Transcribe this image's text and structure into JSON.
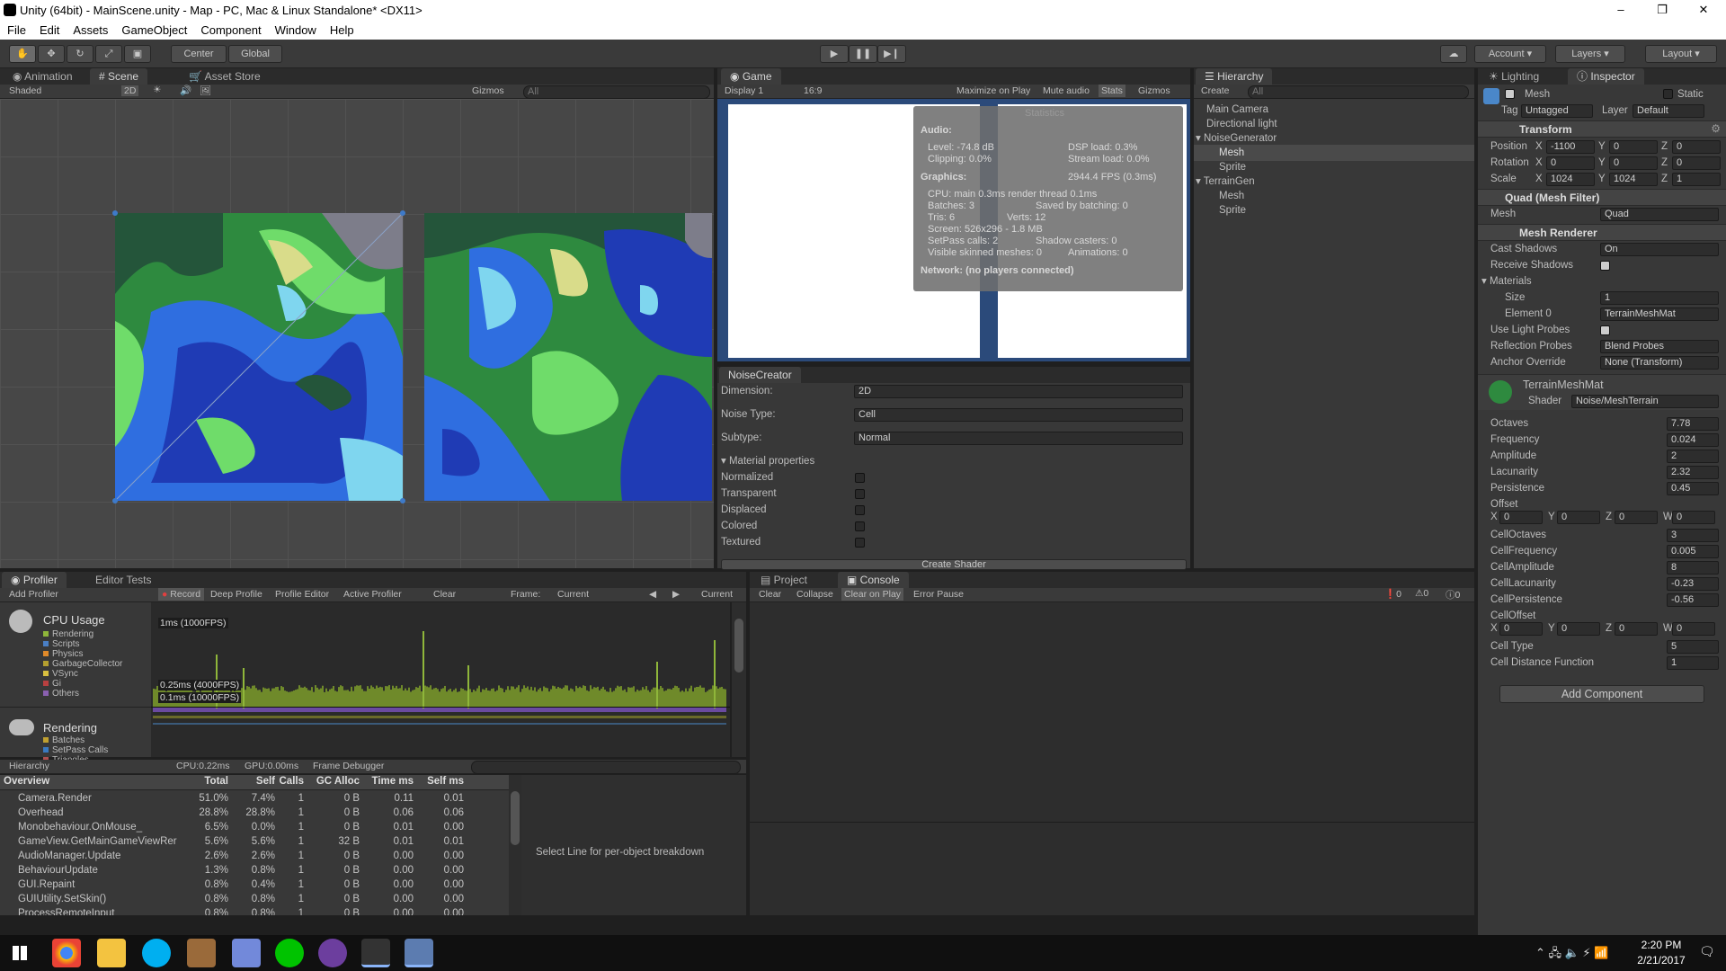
{
  "window": {
    "title": "Unity (64bit) - MainScene.unity - Map - PC, Mac & Linux Standalone* <DX11>",
    "minimize": "–",
    "maximize": "❐",
    "close": "✕"
  },
  "menu": [
    "File",
    "Edit",
    "Assets",
    "GameObject",
    "Component",
    "Window",
    "Help"
  ],
  "toolbar": {
    "center": "Center",
    "global": "Global",
    "account": "Account",
    "layers": "Layers",
    "layout": "Layout"
  },
  "scene_tabs": {
    "animation": "Animation",
    "scene": "Scene",
    "asset_store": "Asset Store",
    "shaded": "Shaded",
    "twod": "2D",
    "gizmos": "Gizmos",
    "search": "All"
  },
  "game": {
    "tab": "Game",
    "display": "Display 1",
    "aspect": "16:9",
    "maximize": "Maximize on Play",
    "mute": "Mute audio",
    "stats": "Stats",
    "gizmos": "Gizmos"
  },
  "stats": {
    "title": "Statistics",
    "audio": "Audio:",
    "level": "Level: -74.8 dB",
    "clipping": "Clipping: 0.0%",
    "dsp": "DSP load: 0.3%",
    "stream": "Stream load: 0.0%",
    "graphics": "Graphics:",
    "fps": "2944.4 FPS (0.3ms)",
    "cpu": "CPU: main 0.3ms  render thread 0.1ms",
    "batches": "Batches: 3",
    "saved": "Saved by batching: 0",
    "tris": "Tris: 6",
    "verts": "Verts: 12",
    "screen": "Screen: 526x296 - 1.8 MB",
    "setpass": "SetPass calls: 2",
    "shadow": "Shadow casters: 0",
    "skinned": "Visible skinned meshes: 0",
    "anims": "Animations: 0",
    "network": "Network: (no players connected)"
  },
  "noise": {
    "tab": "NoiseCreator",
    "dimension_label": "Dimension:",
    "dimension": "2D",
    "type_label": "Noise Type:",
    "type": "Cell",
    "subtype_label": "Subtype:",
    "subtype": "Normal",
    "material": "Material properties",
    "normalized": "Normalized",
    "transparent": "Transparent",
    "displaced": "Displaced",
    "colored": "Colored",
    "textured": "Textured",
    "create": "Create Shader"
  },
  "hierarchy": {
    "tab": "Hierarchy",
    "create": "Create",
    "search": "All",
    "items": [
      "Main Camera",
      "Directional light",
      "NoiseGenerator",
      "Mesh",
      "Sprite",
      "TerrainGen",
      "Mesh",
      "Sprite"
    ]
  },
  "inspector": {
    "lighting_tab": "Lighting",
    "tab": "Inspector",
    "name": "Mesh",
    "static": "Static",
    "tag_label": "Tag",
    "tag": "Untagged",
    "layer_label": "Layer",
    "layer": "Default",
    "transform": "Transform",
    "position": "Position",
    "rotation": "Rotation",
    "scale": "Scale",
    "pos": [
      "-1100",
      "0",
      "0"
    ],
    "rot": [
      "0",
      "0",
      "0"
    ],
    "scl": [
      "1024",
      "1024",
      "1"
    ],
    "x": "X",
    "y": "Y",
    "z": "Z",
    "w": "W",
    "mesh_filter": "Quad (Mesh Filter)",
    "mesh_label": "Mesh",
    "mesh_value": "Quad",
    "mesh_renderer": "Mesh Renderer",
    "cast_shadows": "Cast Shadows",
    "cast_value": "On",
    "receive_shadows": "Receive Shadows",
    "materials": "Materials",
    "size": "Size",
    "size_value": "1",
    "element0": "Element 0",
    "element0_value": "TerrainMeshMat",
    "light_probes": "Use Light Probes",
    "reflection": "Reflection Probes",
    "reflection_value": "Blend Probes",
    "anchor": "Anchor Override",
    "anchor_value": "None (Transform)",
    "material": "TerrainMeshMat",
    "shader_label": "Shader",
    "shader": "Noise/MeshTerrain",
    "props": [
      [
        "Octaves",
        "7.78"
      ],
      [
        "Frequency",
        "0.024"
      ],
      [
        "Amplitude",
        "2"
      ],
      [
        "Lacunarity",
        "2.32"
      ],
      [
        "Persistence",
        "0.45"
      ]
    ],
    "offset": "Offset",
    "offset_vals": [
      "0",
      "0",
      "0",
      "0"
    ],
    "props2": [
      [
        "CellOctaves",
        "3"
      ],
      [
        "CellFrequency",
        "0.005"
      ],
      [
        "CellAmplitude",
        "8"
      ],
      [
        "CellLacunarity",
        "-0.23"
      ],
      [
        "CellPersistence",
        "-0.56"
      ]
    ],
    "celloffset": "CellOffset",
    "celloffset_vals": [
      "0",
      "0",
      "0",
      "0"
    ],
    "props3": [
      [
        "Cell Type",
        "5"
      ],
      [
        "Cell Distance Function",
        "1"
      ]
    ],
    "add_component": "Add Component"
  },
  "profiler": {
    "tab": "Profiler",
    "editor_tests": "Editor Tests",
    "add": "Add Profiler",
    "record": "Record",
    "deep": "Deep Profile",
    "editor": "Profile Editor",
    "active": "Active Profiler",
    "clear": "Clear",
    "frame": "Frame:",
    "current": "Current",
    "current2": "Current",
    "cpu": "CPU Usage",
    "cpu_items": [
      "Rendering",
      "Scripts",
      "Physics",
      "GarbageCollector",
      "VSync",
      "Gi",
      "Others"
    ],
    "rendering": "Rendering",
    "rendering_items": [
      "Batches",
      "SetPass Calls",
      "Triangles"
    ],
    "lbl1": "1ms (1000FPS)",
    "lbl2": "0.25ms (4000FPS)",
    "lbl3": "0.1ms (10000FPS)",
    "hier": "Hierarchy",
    "cpu_time": "CPU:0.22ms",
    "gpu_time": "GPU:0.00ms",
    "frame_debugger": "Frame Debugger",
    "cols": [
      "Overview",
      "Total",
      "Self",
      "Calls",
      "GC Alloc",
      "Time ms",
      "Self ms"
    ],
    "rows": [
      [
        "Camera.Render",
        "51.0%",
        "7.4%",
        "1",
        "0 B",
        "0.11",
        "0.01"
      ],
      [
        "Overhead",
        "28.8%",
        "28.8%",
        "1",
        "0 B",
        "0.06",
        "0.06"
      ],
      [
        "Monobehaviour.OnMouse_",
        "6.5%",
        "0.0%",
        "1",
        "0 B",
        "0.01",
        "0.00"
      ],
      [
        "GameView.GetMainGameViewRer",
        "5.6%",
        "5.6%",
        "1",
        "32 B",
        "0.01",
        "0.01"
      ],
      [
        "AudioManager.Update",
        "2.6%",
        "2.6%",
        "1",
        "0 B",
        "0.00",
        "0.00"
      ],
      [
        "BehaviourUpdate",
        "1.3%",
        "0.8%",
        "1",
        "0 B",
        "0.00",
        "0.00"
      ],
      [
        "GUI.Repaint",
        "0.8%",
        "0.4%",
        "1",
        "0 B",
        "0.00",
        "0.00"
      ],
      [
        "GUIUtility.SetSkin()",
        "0.8%",
        "0.8%",
        "1",
        "0 B",
        "0.00",
        "0.00"
      ],
      [
        "ProcessRemoteInput",
        "0.8%",
        "0.8%",
        "1",
        "0 B",
        "0.00",
        "0.00"
      ]
    ],
    "select_line": "Select Line for per-object breakdown"
  },
  "console": {
    "project": "Project",
    "tab": "Console",
    "clear": "Clear",
    "collapse": "Collapse",
    "clear_on_play": "Clear on Play",
    "error_pause": "Error Pause",
    "err": "0",
    "warn": "0",
    "info": "0"
  },
  "taskbar": {
    "time": "2:20 PM",
    "date": "2/21/2017"
  },
  "colors": {
    "accent": "#3e7ac9",
    "deepwater": "#1f3bb5",
    "water": "#2f6ee0",
    "shallow": "#7fd6ef",
    "sand": "#d9dc8a",
    "grass": "#6fdc6a",
    "forest": "#2e8a3f",
    "darkforest": "#24553a",
    "rock": "#7d7d8a"
  }
}
